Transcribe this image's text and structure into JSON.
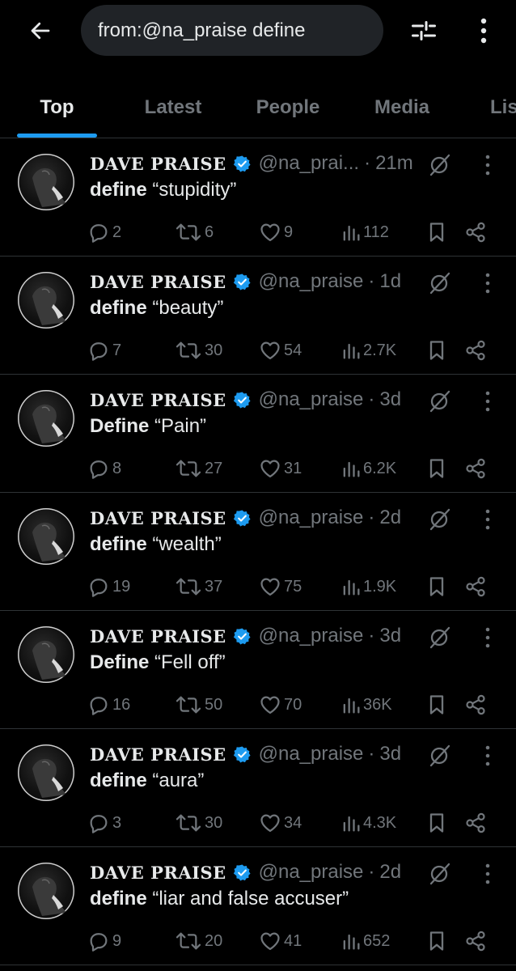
{
  "search": {
    "query": "from:@na_praise define"
  },
  "tabs": [
    {
      "label": "Top",
      "active": true
    },
    {
      "label": "Latest",
      "active": false
    },
    {
      "label": "People",
      "active": false
    },
    {
      "label": "Media",
      "active": false
    },
    {
      "label": "Lis",
      "active": false
    }
  ],
  "colors": {
    "accent": "#1d9bf0",
    "text": "#e7e9ea",
    "muted": "#71767b",
    "divider": "#2f3336",
    "search_bg": "#202327"
  },
  "icons": {
    "back": "arrow-left-icon",
    "filter": "sliders-icon",
    "menu": "more-vertical-icon",
    "verified": "verified-badge-icon",
    "grok": "grok-icon",
    "reply": "reply-icon",
    "repost": "repost-icon",
    "like": "heart-icon",
    "views": "views-icon",
    "bookmark": "bookmark-icon",
    "share": "share-icon"
  },
  "tweets": [
    {
      "name": "DAVE PRAISE",
      "handle": "@na_prai...",
      "dot": "·",
      "time": "21m",
      "keyword": "define",
      "quote": "“stupidity”",
      "replies": "2",
      "reposts": "6",
      "likes": "9",
      "views": "112"
    },
    {
      "name": "DAVE PRAISE",
      "handle": "@na_praise",
      "dot": "·",
      "time": "1d",
      "keyword": "define",
      "quote": "“beauty”",
      "replies": "7",
      "reposts": "30",
      "likes": "54",
      "views": "2.7K"
    },
    {
      "name": "DAVE PRAISE",
      "handle": "@na_praise",
      "dot": "·",
      "time": "3d",
      "keyword": "Define",
      "quote": "“Pain”",
      "replies": "8",
      "reposts": "27",
      "likes": "31",
      "views": "6.2K"
    },
    {
      "name": "DAVE PRAISE",
      "handle": "@na_praise",
      "dot": "·",
      "time": "2d",
      "keyword": "define",
      "quote": "“wealth”",
      "replies": "19",
      "reposts": "37",
      "likes": "75",
      "views": "1.9K"
    },
    {
      "name": "DAVE PRAISE",
      "handle": "@na_praise",
      "dot": "·",
      "time": "3d",
      "keyword": "Define",
      "quote": "“Fell off”",
      "replies": "16",
      "reposts": "50",
      "likes": "70",
      "views": "36K"
    },
    {
      "name": "DAVE PRAISE",
      "handle": "@na_praise",
      "dot": "·",
      "time": "3d",
      "keyword": "define",
      "quote": "“aura”",
      "replies": "3",
      "reposts": "30",
      "likes": "34",
      "views": "4.3K"
    },
    {
      "name": "DAVE PRAISE",
      "handle": "@na_praise",
      "dot": "·",
      "time": "2d",
      "keyword": "define",
      "quote": "“liar and false accuser”",
      "replies": "9",
      "reposts": "20",
      "likes": "41",
      "views": "652"
    }
  ]
}
